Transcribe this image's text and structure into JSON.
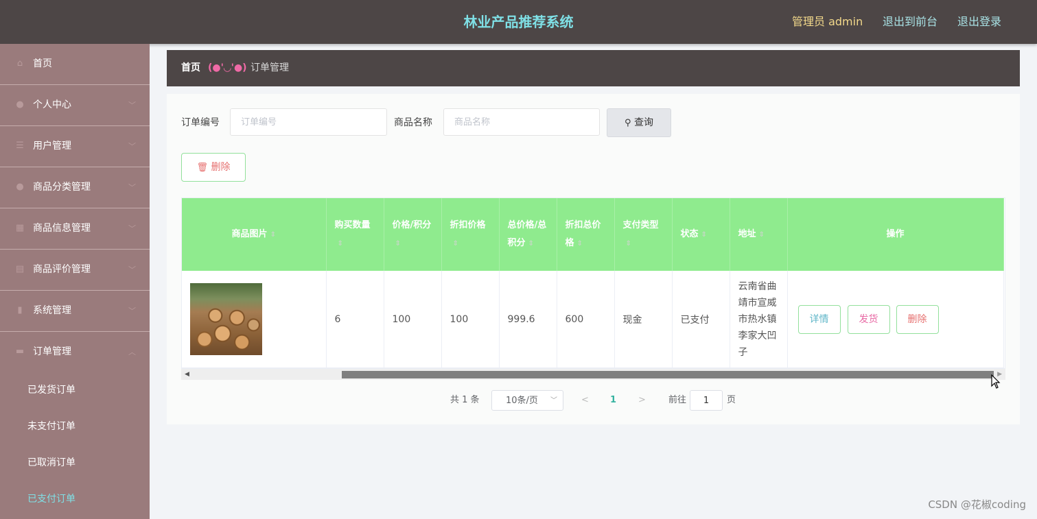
{
  "header": {
    "title": "林业产品推荐系统",
    "admin_label": "管理员 admin",
    "front_label": "退出到前台",
    "logout_label": "退出登录"
  },
  "sidebar": {
    "items": [
      {
        "label": "首页",
        "icon": "home-icon"
      },
      {
        "label": "个人中心",
        "icon": "user-icon"
      },
      {
        "label": "用户管理",
        "icon": "list-icon"
      },
      {
        "label": "商品分类管理",
        "icon": "user-icon"
      },
      {
        "label": "商品信息管理",
        "icon": "grid-icon"
      },
      {
        "label": "商品评价管理",
        "icon": "clipboard-icon"
      },
      {
        "label": "系统管理",
        "icon": "bar-chart-icon"
      },
      {
        "label": "订单管理",
        "icon": "card-icon"
      }
    ],
    "sub_items": [
      "已发货订单",
      "未支付订单",
      "已取消订单",
      "已支付订单"
    ],
    "active_sub": "已支付订单"
  },
  "breadcrumb": {
    "home": "首页",
    "separator": "(●'◡'●)",
    "current": "订单管理"
  },
  "search": {
    "order_label": "订单编号",
    "order_placeholder": "订单编号",
    "product_label": "商品名称",
    "product_placeholder": "商品名称",
    "query_label": "查询"
  },
  "delete_label": "删除",
  "table": {
    "headers": [
      "商品图片",
      "购买数量",
      "价格/积分",
      "折扣价格",
      "总价格/总积分",
      "折扣总价格",
      "支付类型",
      "状态",
      "地址",
      "操作"
    ],
    "rows": [
      {
        "quantity": "6",
        "price": "100",
        "discount_price": "100",
        "total": "999.6",
        "discount_total": "600",
        "pay_type": "现金",
        "status": "已支付",
        "address": "云南省曲靖市宣威市热水镇李家大凹子",
        "actions": {
          "detail": "详情",
          "ship": "发货",
          "delete": "删除"
        }
      }
    ]
  },
  "pagination": {
    "total": "共 1 条",
    "page_size": "10条/页",
    "current_page": "1",
    "goto_label": "前往",
    "goto_value": "1",
    "page_suffix": "页"
  },
  "watermark": "CSDN @花椒coding",
  "colors": {
    "header_bg": "#4d4646",
    "sidebar_bg": "#9a7b7c",
    "table_header_bg": "#8feb8e",
    "title_color": "#7fe0e6",
    "accent_pink": "#e86aa5"
  }
}
